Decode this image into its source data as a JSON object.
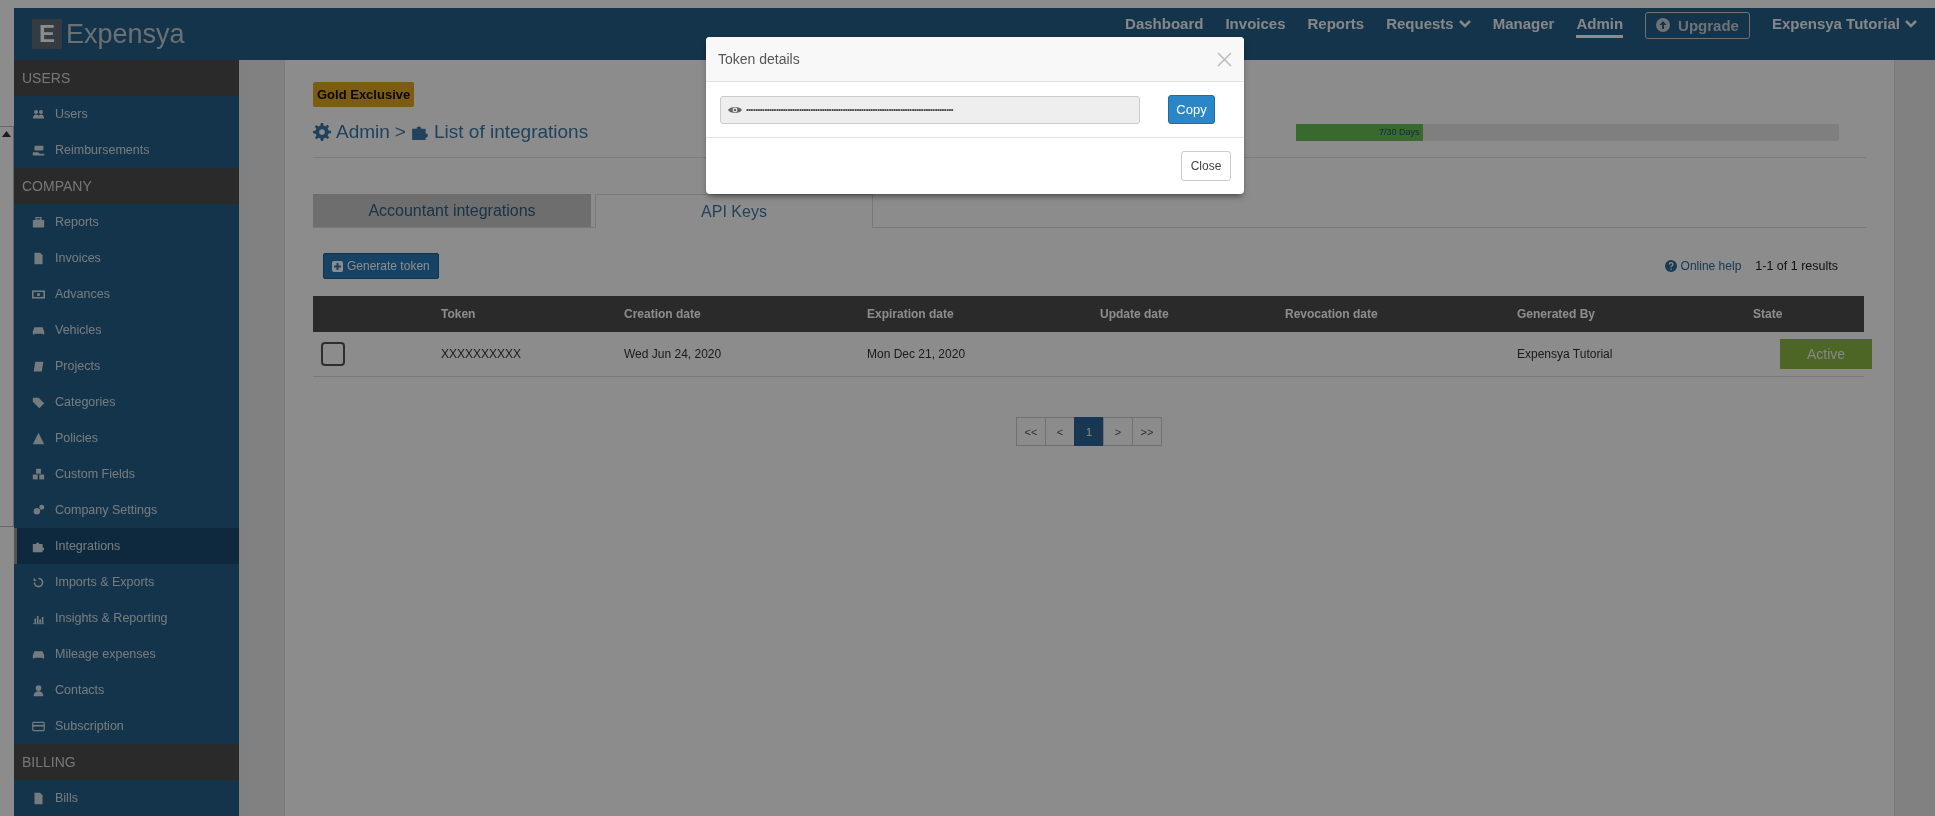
{
  "navbar": {
    "logo_letter": "E",
    "logo_name": "Expensya",
    "items": [
      {
        "label": "Dashboard",
        "kind": "link",
        "selected": false
      },
      {
        "label": "Invoices",
        "kind": "link",
        "selected": false
      },
      {
        "label": "Reports",
        "kind": "link",
        "selected": false
      },
      {
        "label": "Requests",
        "kind": "dropdown",
        "selected": false
      },
      {
        "label": "Manager",
        "kind": "link",
        "selected": false
      },
      {
        "label": "Admin",
        "kind": "link",
        "selected": true
      },
      {
        "label": "Upgrade",
        "kind": "button"
      },
      {
        "label": "Expensya Tutorial",
        "kind": "dropdown",
        "selected": false
      }
    ]
  },
  "sidebar": {
    "sections": [
      {
        "title": "USERS",
        "items": [
          {
            "label": "Users",
            "selected": false
          },
          {
            "label": "Reimbursements",
            "selected": false
          }
        ]
      },
      {
        "title": "COMPANY",
        "items": [
          {
            "label": "Reports",
            "selected": false
          },
          {
            "label": "Invoices",
            "selected": false
          },
          {
            "label": "Advances",
            "selected": false
          },
          {
            "label": "Vehicles",
            "selected": false
          },
          {
            "label": "Projects",
            "selected": false
          },
          {
            "label": "Categories",
            "selected": false
          },
          {
            "label": "Policies",
            "selected": false
          },
          {
            "label": "Custom Fields",
            "selected": false
          },
          {
            "label": "Company Settings",
            "selected": false
          },
          {
            "label": "Integrations",
            "selected": true
          },
          {
            "label": "Imports & Exports",
            "selected": false
          },
          {
            "label": "Insights & Reporting",
            "selected": false
          },
          {
            "label": "Mileage expenses",
            "selected": false
          },
          {
            "label": "Contacts",
            "selected": false
          },
          {
            "label": "Subscription",
            "selected": false
          }
        ]
      },
      {
        "title": "BILLING",
        "items": [
          {
            "label": "Bills",
            "selected": false
          }
        ]
      }
    ]
  },
  "content": {
    "badge": "Gold Exclusive",
    "breadcrumb": {
      "parent": "Admin",
      "separator": ">",
      "current": "List of integrations"
    },
    "trial": {
      "label": "7/30 Days",
      "level": 0.233
    },
    "tabs": [
      {
        "label": "Accountant integrations",
        "selected": false
      },
      {
        "label": "API Keys",
        "selected": true
      }
    ],
    "generate_button": "Generate token",
    "online_help": "Online help",
    "results": "1-1 of 1 results",
    "table": {
      "columns": [
        "Token",
        "Creation date",
        "Expiration date",
        "Update date",
        "Revocation date",
        "Generated By",
        "State"
      ],
      "rows": [
        {
          "checked": false,
          "token": "XXXXXXXXXX",
          "creation_date": "Wed Jun 24, 2020",
          "expiration_date": "Mon Dec 21, 2020",
          "generated_by": "Expensya Tutorial",
          "state": "Active"
        }
      ]
    },
    "pagination": [
      {
        "label": "<<",
        "selected": false
      },
      {
        "label": "<",
        "selected": false
      },
      {
        "label": "1",
        "selected": true
      },
      {
        "label": ">",
        "selected": false
      },
      {
        "label": ">>",
        "selected": false
      }
    ]
  },
  "modal": {
    "title": "Token details",
    "token": "••••••••••••••••••••••••••••••••••••••••••••••••••••••••••••••••••••••••••••••••••••••••••",
    "copy_button": "Copy",
    "close_button": "Close"
  }
}
